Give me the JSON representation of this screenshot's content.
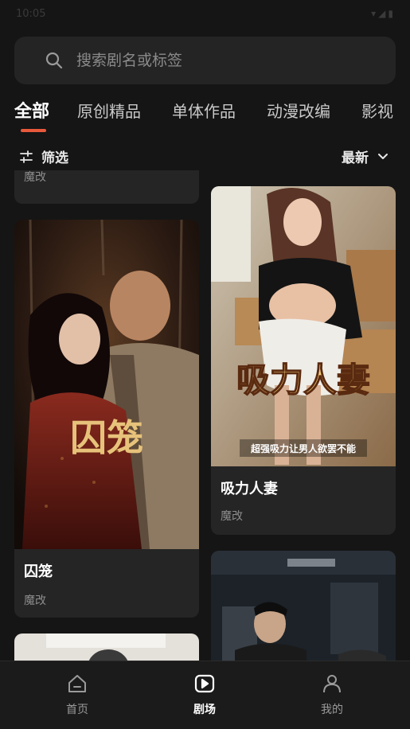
{
  "status": {
    "time": "10:05",
    "icons": "▾◢▮"
  },
  "search": {
    "placeholder": "搜索剧名或标签"
  },
  "tabs": [
    {
      "label": "全部",
      "active": true
    },
    {
      "label": "原创精品"
    },
    {
      "label": "单体作品"
    },
    {
      "label": "动漫改编"
    },
    {
      "label": "影视"
    }
  ],
  "filter": {
    "label": "筛选"
  },
  "sort": {
    "label": "最新"
  },
  "cards": [
    {
      "title": "",
      "tag": "魔改"
    },
    {
      "title": "囚笼",
      "tag": "魔改",
      "cover_text": "囚笼"
    },
    {
      "title": "吸力人妻",
      "tag": "魔改",
      "cover_text": "吸力人妻",
      "cover_subtext": "超强吸力让男人欲罢不能"
    },
    {
      "title": "",
      "tag": ""
    },
    {
      "title": "",
      "tag": ""
    }
  ],
  "nav": [
    {
      "label": "首页",
      "icon": "home-icon"
    },
    {
      "label": "剧场",
      "icon": "play-icon",
      "active": true
    },
    {
      "label": "我的",
      "icon": "user-icon"
    }
  ],
  "colors": {
    "accent": "#e8593c",
    "background": "#151515",
    "card": "#252525"
  }
}
